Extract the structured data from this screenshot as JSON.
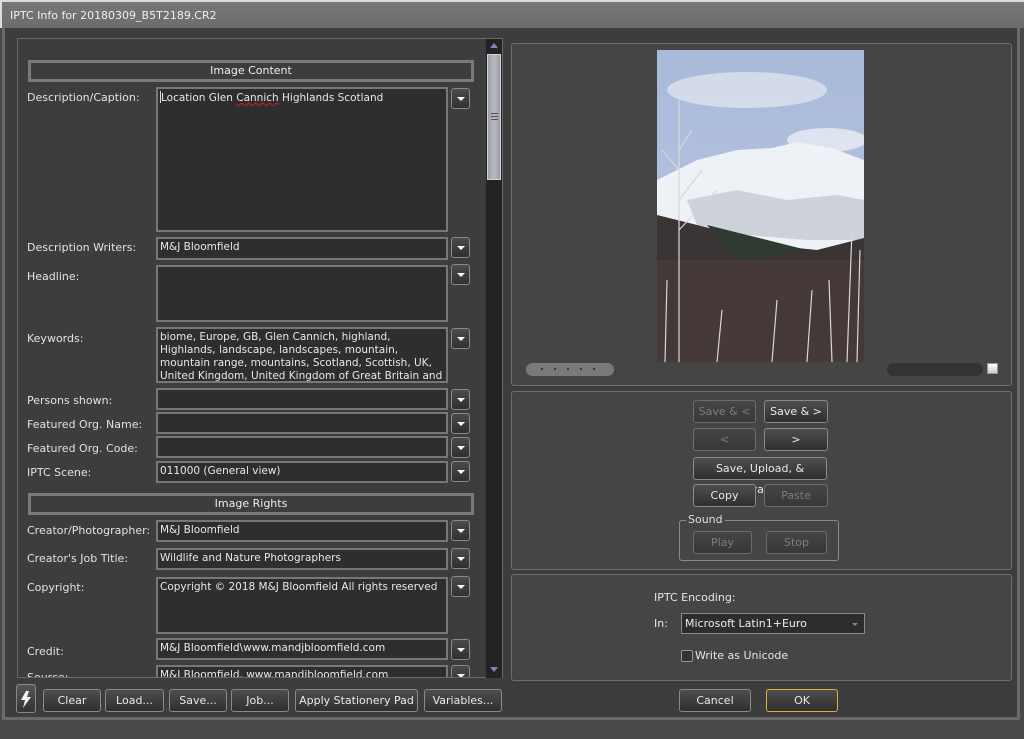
{
  "window": {
    "title": "IPTC Info for 20180309_B5T2189.CR2"
  },
  "sections": {
    "image_content": "Image Content",
    "image_rights": "Image Rights"
  },
  "fields": {
    "description_caption": {
      "label": "Description/Caption:",
      "value": "Location Glen Cannich Highlands Scotland",
      "pre": "Location Glen ",
      "misspelled": "Cannich",
      "post": " Highlands Scotland"
    },
    "description_writers": {
      "label": "Description Writers:",
      "value": "M&J Bloomfield"
    },
    "headline": {
      "label": "Headline:",
      "value": ""
    },
    "keywords": {
      "label": "Keywords:",
      "value": "biome, Europe, GB, Glen Cannich, highland, Highlands, landscape, landscapes, mountain, mountain range, mountains, Scotland, Scottish, UK, United Kingdom, United Kingdom of Great Britain and Northern Ireland, uplands"
    },
    "persons_shown": {
      "label": "Persons shown:",
      "value": ""
    },
    "featured_org_name": {
      "label": "Featured Org. Name:",
      "value": ""
    },
    "featured_org_code": {
      "label": "Featured Org. Code:",
      "value": ""
    },
    "iptc_scene": {
      "label": "IPTC Scene:",
      "value": "011000 (General view)"
    },
    "creator_photographer": {
      "label": "Creator/Photographer:",
      "value": "M&J Bloomfield"
    },
    "creators_job_title": {
      "label": "Creator's Job Title:",
      "value": "Wildlife and Nature Photographers"
    },
    "copyright": {
      "label": "Copyright:",
      "value": "Copyright © 2018 M&J Bloomfield All rights reserved"
    },
    "credit": {
      "label": "Credit:",
      "value": "M&J Bloomfield\\www.mandjbloomfield.com"
    },
    "source": {
      "label": "Source:",
      "value": "M&J Bloomfield, www.mandjbloomfield.com"
    }
  },
  "toolbar": {
    "clear": "Clear",
    "load": "Load...",
    "save": "Save...",
    "job": "Job...",
    "apply_stationery_pad": "Apply Stationery Pad",
    "variables": "Variables..."
  },
  "navigation": {
    "save_prev": "Save & <",
    "save_next": "Save & >",
    "prev": "<",
    "next": ">",
    "save_upload_advance": "Save, Upload, & Advance",
    "copy": "Copy",
    "paste": "Paste"
  },
  "sound": {
    "legend": "Sound",
    "play": "Play",
    "stop": "Stop"
  },
  "encoding": {
    "title": "IPTC Encoding:",
    "in_label": "In:",
    "selected": "Microsoft Latin1+Euro",
    "write_unicode_label": "Write as Unicode",
    "write_unicode_checked": false
  },
  "dialog": {
    "cancel": "Cancel",
    "ok": "OK"
  },
  "colors": {
    "ok_accent": "#d8b23a",
    "scroll_arrow": "#7b89b8",
    "spellcheck": "#d02020"
  }
}
